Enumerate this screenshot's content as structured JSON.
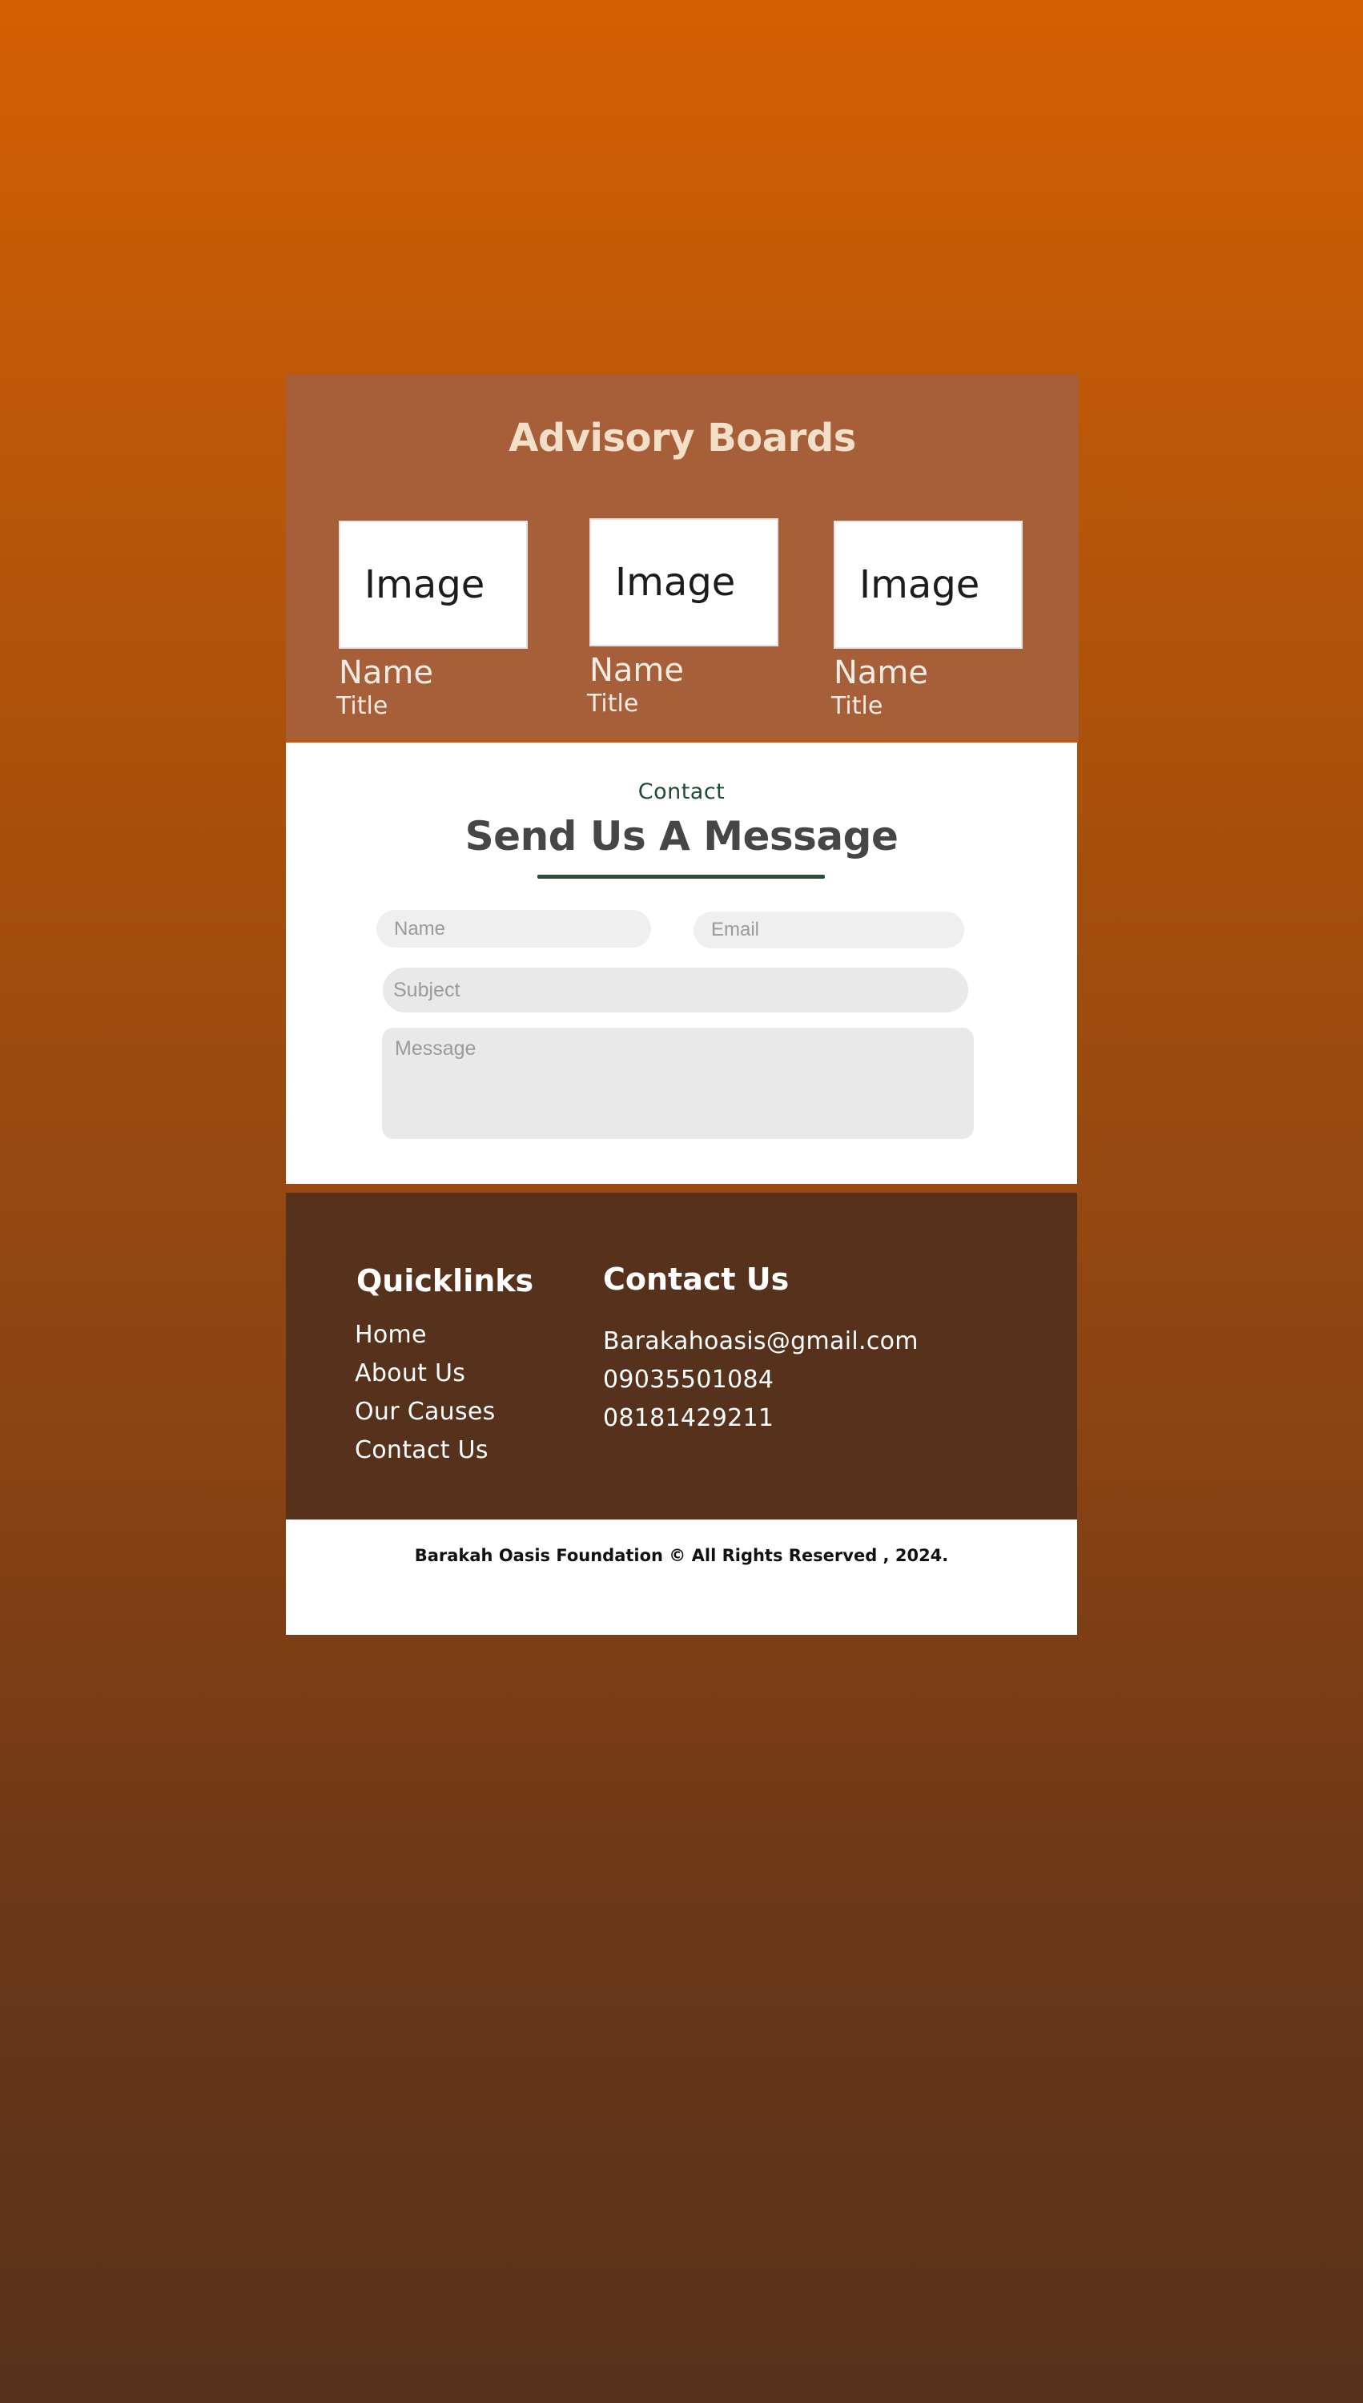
{
  "advisory": {
    "title": "Advisory Boards",
    "members": [
      {
        "image_label": "Image",
        "name": "Name",
        "title": "Title"
      },
      {
        "image_label": "Image",
        "name": "Name",
        "title": "Title"
      },
      {
        "image_label": "Image",
        "name": "Name",
        "title": "Title"
      }
    ]
  },
  "contact": {
    "eyebrow": "Contact",
    "heading": "Send Us A Message",
    "name_placeholder": "Name",
    "email_placeholder": "Email",
    "subject_placeholder": "Subject",
    "message_placeholder": "Message"
  },
  "footer": {
    "quicklinks_title": "Quicklinks",
    "links": [
      "Home",
      "About Us",
      "Our Causes",
      "Contact Us"
    ],
    "contact_title": "Contact Us",
    "email": "Barakahoasis@gmail.com",
    "phones": [
      "09035501084",
      "08181429211"
    ]
  },
  "copyright": "Barakah Oasis Foundation © All Rights Reserved ,  2024."
}
